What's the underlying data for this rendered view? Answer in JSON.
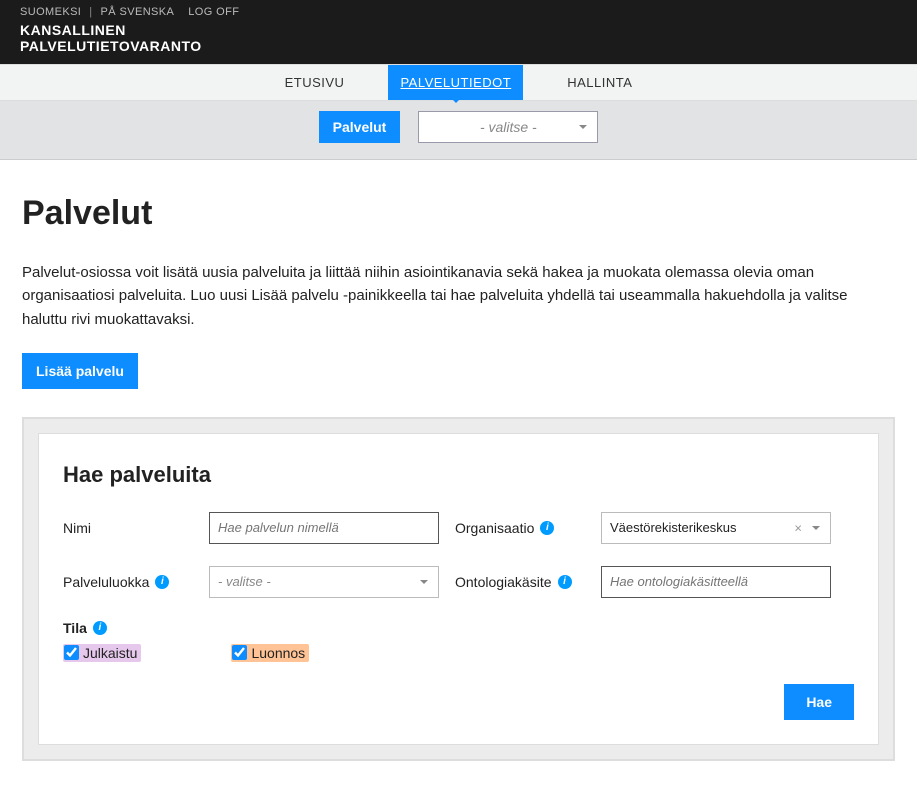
{
  "topbar": {
    "lang_fi": "SUOMEKSI",
    "lang_sv": "PÅ SVENSKA",
    "logoff": "LOG OFF",
    "brand_line1": "KANSALLINEN",
    "brand_line2": "PALVELUTIETOVARANTO"
  },
  "nav": {
    "items": [
      {
        "label": "ETUSIVU"
      },
      {
        "label": "PALVELUTIEDOT"
      },
      {
        "label": "HALLINTA"
      }
    ],
    "active_index": 1
  },
  "subnav": {
    "cta": "Palvelut",
    "select_placeholder": "- valitse -"
  },
  "page": {
    "title": "Palvelut",
    "lead": "Palvelut-osiossa voit lisätä uusia palveluita ja liittää niihin asiointikanavia sekä hakea ja muokata olemassa olevia oman organisaatiosi palveluita. Luo uusi Lisää palvelu -painikkeella tai hae palveluita yhdellä tai useammalla hakuehdolla ja valitse haluttu rivi muokattavaksi.",
    "add_btn": "Lisää palvelu"
  },
  "search": {
    "heading": "Hae palveluita",
    "name_label": "Nimi",
    "name_placeholder": "Hae palvelun nimellä",
    "org_label": "Organisaatio",
    "org_value": "Väestörekisterikeskus",
    "class_label": "Palveluluokka",
    "class_placeholder": "- valitse -",
    "onto_label": "Ontologiakäsite",
    "onto_placeholder": "Hae ontologiakäsitteellä",
    "tila_label": "Tila",
    "chk_published": "Julkaistu",
    "chk_draft": "Luonnos",
    "submit": "Hae"
  }
}
